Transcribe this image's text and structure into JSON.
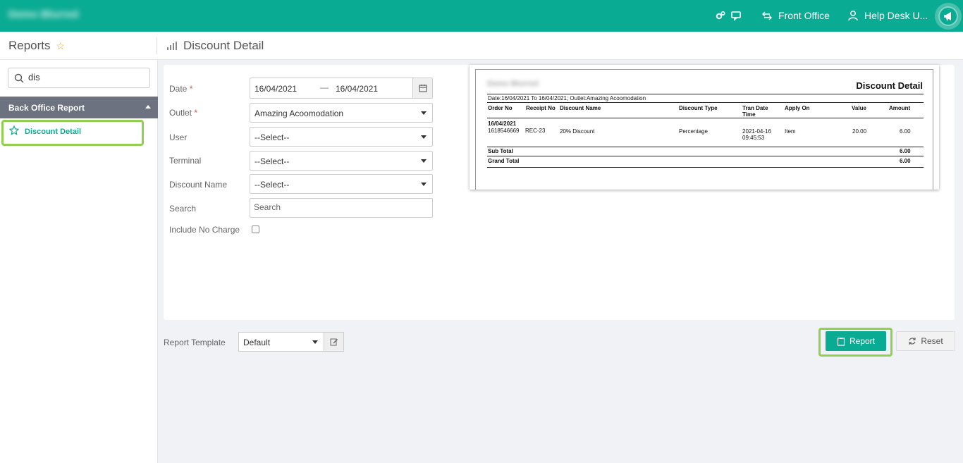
{
  "topbar": {
    "brand": "Demo Blurred",
    "front_office_label": "Front Office",
    "help_desk_label": "Help Desk U..."
  },
  "subheader": {
    "section_title": "Reports",
    "page_title": "Discount Detail"
  },
  "sidebar": {
    "search_value": "dis",
    "group_label": "Back Office Report",
    "items": [
      {
        "label": "Discount Detail",
        "active": true
      }
    ]
  },
  "form": {
    "date_label": "Date",
    "date_from": "16/04/2021",
    "date_sep": "—",
    "date_to": "16/04/2021",
    "outlet_label": "Outlet",
    "outlet_value": "Amazing Acoomodation",
    "user_label": "User",
    "user_value": "--Select--",
    "terminal_label": "Terminal",
    "terminal_value": "--Select--",
    "discount_name_label": "Discount Name",
    "discount_name_value": "--Select--",
    "search_label": "Search",
    "search_placeholder": "Search",
    "include_no_charge_label": "Include No Charge",
    "include_no_charge_checked": false,
    "required_mark": "*"
  },
  "preview": {
    "company": "Demo Blurred",
    "title": "Discount Detail",
    "subtitle": "Date:16/04/2021 To 16/04/2021; Outlet:Amazing Acoomodation",
    "columns": {
      "order_no": "Order No",
      "receipt_no": "Receipt No",
      "discount_name": "Discount Name",
      "discount_type": "Discount Type",
      "tran_date_1": "Tran Date",
      "tran_date_2": "Time",
      "apply_on": "Apply On",
      "value": "Value",
      "amount": "Amount"
    },
    "group_date": "16/04/2021",
    "row": {
      "order_no": "1618546669",
      "receipt_no": "REC-23",
      "discount_name": "20% Discount",
      "discount_type": "Percentage",
      "tran_date": "2021-04-16",
      "tran_time": "09:45:53",
      "apply_on": "Item",
      "value": "20.00",
      "amount": "6.00"
    },
    "sub_total_label": "Sub Total",
    "sub_total_value": "6.00",
    "grand_total_label": "Grand Total",
    "grand_total_value": "6.00"
  },
  "bottom": {
    "template_label": "Report Template",
    "template_value": "Default",
    "report_button": "Report",
    "reset_button": "Reset"
  },
  "colors": {
    "accent": "#0aab93",
    "highlight": "#8fd14f",
    "sidebar_header": "#6c7280"
  }
}
